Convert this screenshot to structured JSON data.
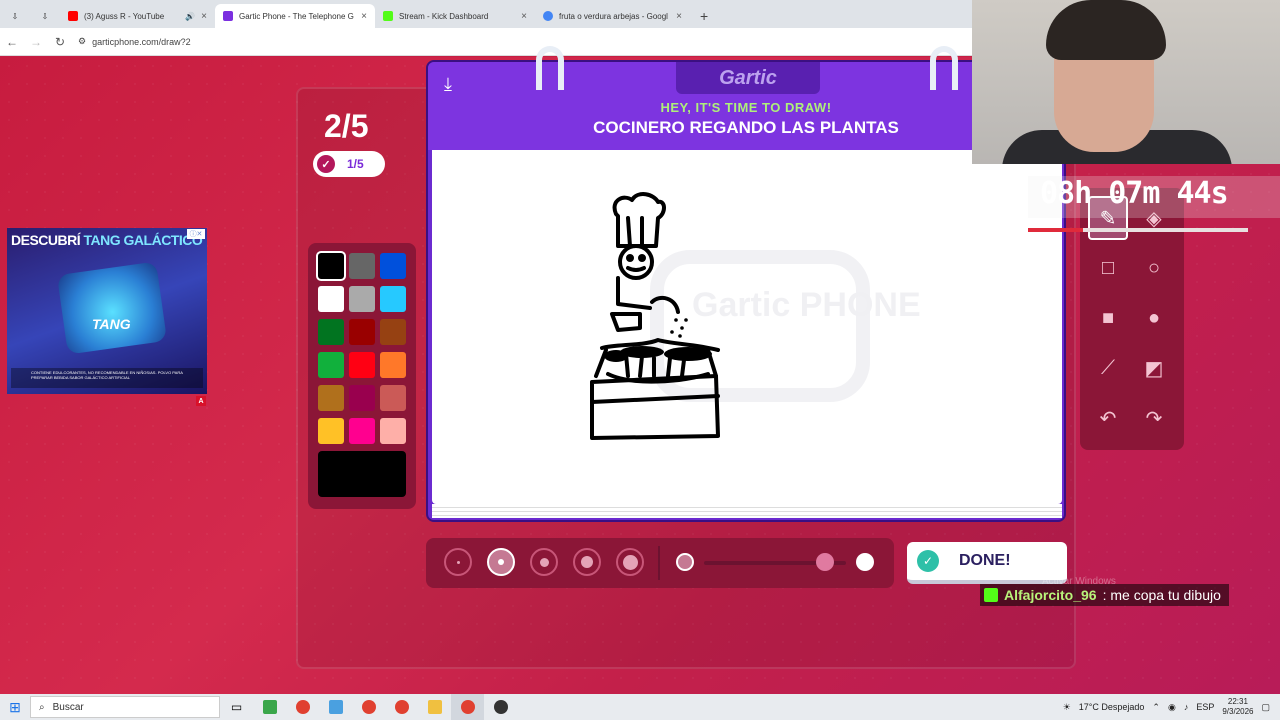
{
  "browser": {
    "tabs": [
      {
        "title": "(3) Aguss R - YouTube",
        "favicon_color": "#ff0000"
      },
      {
        "title": "Gartic Phone - The Telephone G",
        "favicon_color": "#7b2fe0",
        "active": true
      },
      {
        "title": "Stream - Kick Dashboard",
        "favicon_color": "#53fc18"
      },
      {
        "title": "fruta o verdura arbejas - Googl",
        "favicon_color": "#4285f4"
      }
    ],
    "url": "garticphone.com/draw?2"
  },
  "game": {
    "round": "2/5",
    "progress": "1/5",
    "logo": "Gartic",
    "instruction": "HEY, IT'S TIME TO DRAW!",
    "prompt": "COCINERO REGANDO LAS PLANTAS",
    "watermark": "Gartic PHONE",
    "done_label": "DONE!",
    "palette": [
      "#000000",
      "#666666",
      "#0050dc",
      "#ffffff",
      "#aaaaaa",
      "#26c9ff",
      "#017420",
      "#990000",
      "#964112",
      "#11b03c",
      "#ff0013",
      "#ff7829",
      "#b0701c",
      "#99004e",
      "#cb5a57",
      "#ffc126",
      "#ff008f",
      "#feafa8"
    ],
    "selected_color": "#000000",
    "brush_sizes": 5,
    "selected_brush_index": 1,
    "opacity_value": 0.85
  },
  "ad": {
    "title_a": "DESCUBRÍ",
    "title_b": "TANG GALÁCTICO",
    "brand": "TANG",
    "fine_print": "CONTIENE EDULCORANTES, NO RECOMENDABLE EN NIÑOS/AS. POLVO PARA PREPARAR BEBIDA SABOR GALÁCTICO ARTIFICIAL",
    "badge": "A"
  },
  "stream": {
    "timer": "08h 07m 44s",
    "timer_progress": 0.25,
    "chat_user": "Alfajorcito_96",
    "chat_message": ": me copa tu dibujo",
    "activate_windows": "Activar Windows"
  },
  "taskbar": {
    "search_placeholder": "Buscar",
    "weather": "17°C  Despejado",
    "lang": "ESP",
    "time": "22:31",
    "date": "9/3/2026"
  }
}
